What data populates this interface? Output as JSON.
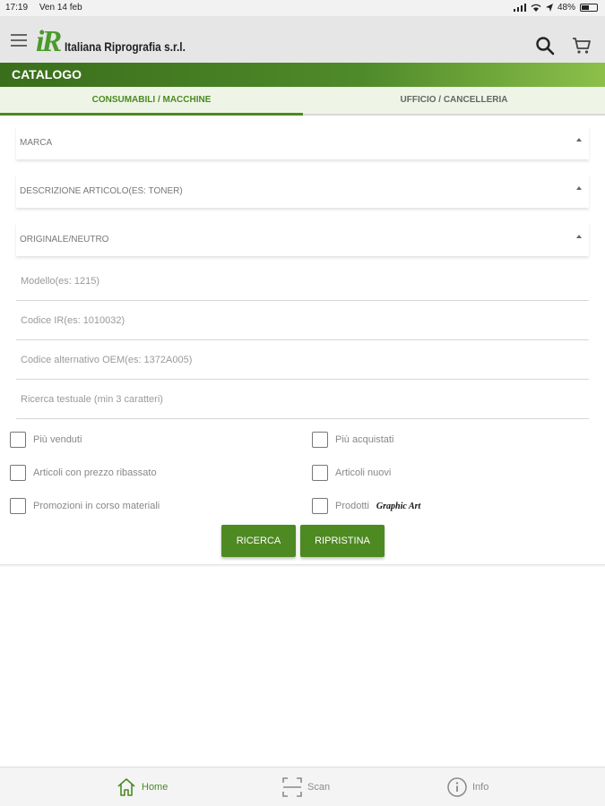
{
  "status_bar": {
    "time": "17:19",
    "date": "Ven 14 feb",
    "battery": "48%"
  },
  "header": {
    "logo_mark": "iR",
    "company_name": "Italiana Riprografia s.r.l."
  },
  "catalog": {
    "title": "CATALOGO"
  },
  "tabs": [
    {
      "label": "CONSUMABILI / MACCHINE",
      "active": true
    },
    {
      "label": "UFFICIO / CANCELLERIA",
      "active": false
    }
  ],
  "selects": {
    "brand": "MARCA",
    "description": "DESCRIZIONE ARTICOLO(ES: TONER)",
    "original": "ORIGINALE/NEUTRO"
  },
  "inputs": {
    "model_placeholder": "Modello(es: 1215)",
    "code_placeholder": "Codice IR(es: 1010032)",
    "oem_placeholder": "Codice alternativo OEM(es: 1372A005)",
    "text_placeholder": "Ricerca testuale (min 3 caratteri)"
  },
  "checkboxes": {
    "best_sellers": "Più venduti",
    "most_purchased": "Più acquistati",
    "discounted": "Articoli con prezzo ribassato",
    "new_items": "Articoli nuovi",
    "promotions": "Promozioni in corso materiali",
    "products": "Prodotti",
    "products_brand": "Graphic Art"
  },
  "buttons": {
    "search": "RICERCA",
    "reset": "RIPRISTINA"
  },
  "bottom_nav": {
    "home": "Home",
    "scan": "Scan",
    "info": "Info"
  },
  "colors": {
    "accent": "#4e8a22",
    "header_bg": "#e6e6e6",
    "tab_bg": "#eef5e6"
  },
  "icons": [
    "menu-icon",
    "search-icon",
    "cart-icon",
    "home-icon",
    "scan-icon",
    "info-icon"
  ]
}
